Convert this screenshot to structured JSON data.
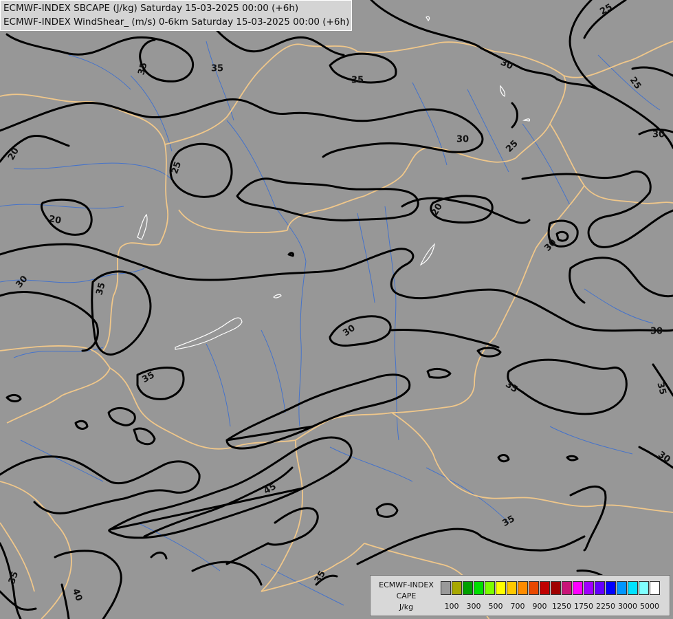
{
  "title_lines": [
    "ECMWF-INDEX SBCAPE (J/kg) Saturday 15-03-2025 00:00 (+6h)",
    "ECMWF-INDEX WindShear_ (m/s) 0-6km Saturday 15-03-2025 00:00 (+6h)"
  ],
  "legend": {
    "title_lines": [
      "ECMWF-INDEX",
      "CAPE",
      "J/kg"
    ],
    "colors": [
      "#999999",
      "#a8a800",
      "#00a000",
      "#00e000",
      "#7cff00",
      "#ffff00",
      "#ffc800",
      "#ff8c00",
      "#e84800",
      "#c00000",
      "#a00000",
      "#c81478",
      "#ff00ff",
      "#a000ff",
      "#6400ff",
      "#0000ff",
      "#0096ff",
      "#00e1ff",
      "#80ffff",
      "#ffffff"
    ],
    "tick_labels": [
      "100",
      "300",
      "500",
      "700",
      "900",
      "1250",
      "1750",
      "2250",
      "3000",
      "5000"
    ]
  },
  "contour_labels": [
    "25",
    "35",
    "35",
    "35",
    "30",
    "25",
    "20",
    "30",
    "25",
    "30",
    "25",
    "20",
    "20",
    "30",
    "30",
    "35",
    "30",
    "35",
    "30",
    "35",
    "35",
    "45",
    "35",
    "40",
    "35",
    "35",
    "30"
  ],
  "colors": {
    "background": "#979797",
    "borders": "#f0c78a",
    "rivers": "#3c6fd0",
    "contours": "#000000",
    "lakes": "#ffffff"
  }
}
